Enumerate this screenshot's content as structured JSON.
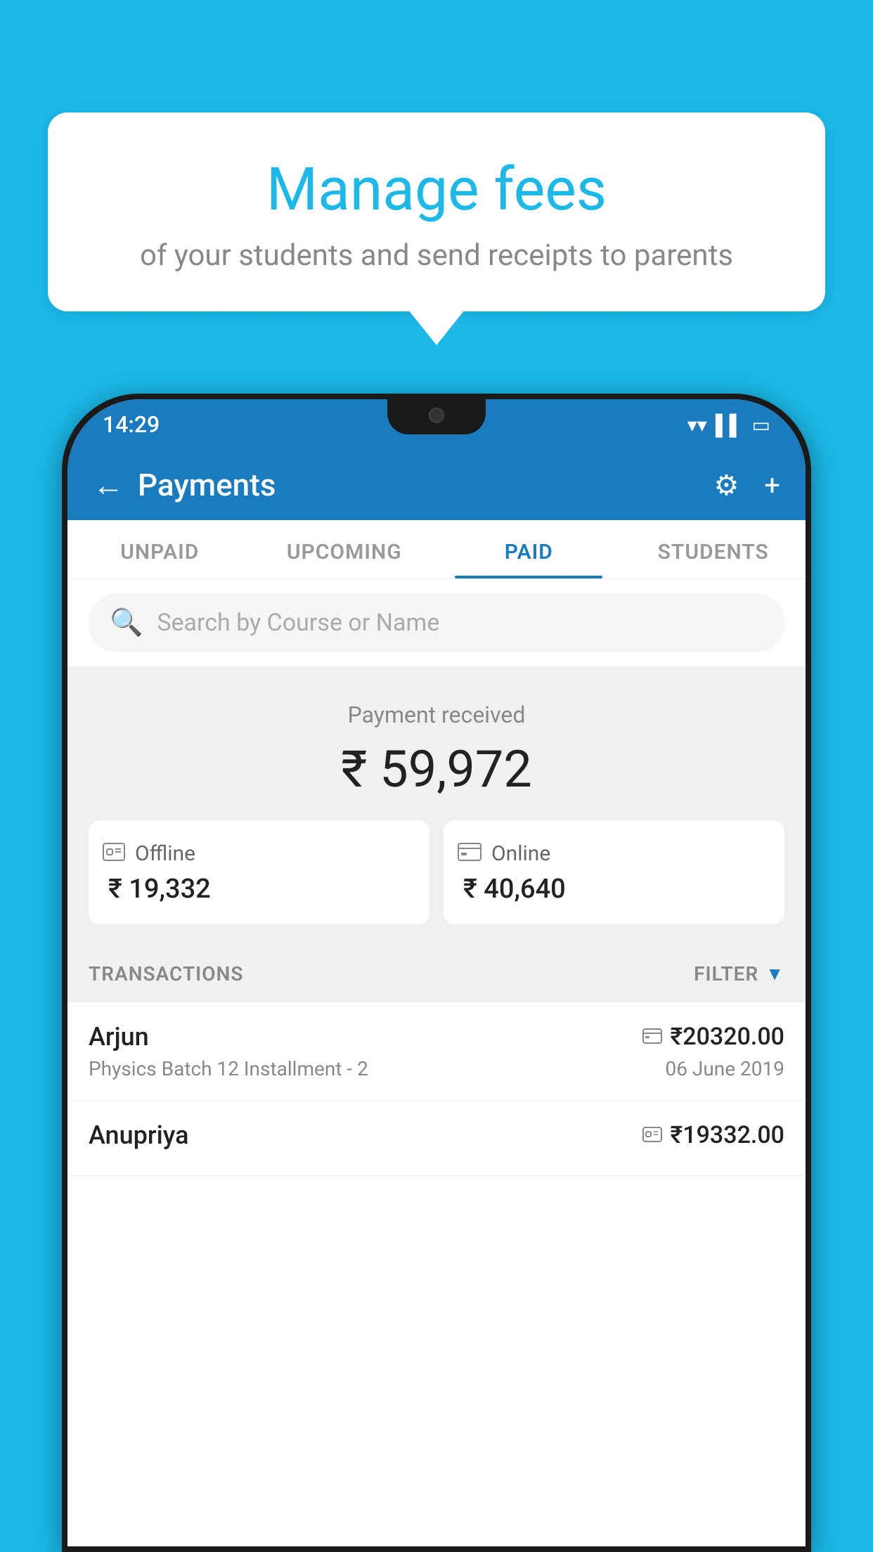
{
  "bubble": {
    "title": "Manage fees",
    "subtitle": "of your students and send receipts to parents"
  },
  "statusBar": {
    "time": "14:29",
    "icons": [
      "wifi",
      "signal",
      "battery"
    ]
  },
  "appBar": {
    "title": "Payments",
    "backLabel": "←",
    "settingsLabel": "⚙",
    "addLabel": "+"
  },
  "tabs": [
    {
      "label": "UNPAID",
      "active": false
    },
    {
      "label": "UPCOMING",
      "active": false
    },
    {
      "label": "PAID",
      "active": true
    },
    {
      "label": "STUDENTS",
      "active": false
    }
  ],
  "search": {
    "placeholder": "Search by Course or Name"
  },
  "paymentSummary": {
    "label": "Payment received",
    "total": "₹ 59,972",
    "offline": {
      "label": "Offline",
      "amount": "₹ 19,332"
    },
    "online": {
      "label": "Online",
      "amount": "₹ 40,640"
    }
  },
  "transactions": {
    "sectionLabel": "TRANSACTIONS",
    "filterLabel": "FILTER",
    "items": [
      {
        "name": "Arjun",
        "course": "Physics Batch 12 Installment - 2",
        "amount": "₹20320.00",
        "date": "06 June 2019",
        "paymentType": "card"
      },
      {
        "name": "Anupriya",
        "course": "",
        "amount": "₹19332.00",
        "date": "",
        "paymentType": "cash"
      }
    ]
  }
}
